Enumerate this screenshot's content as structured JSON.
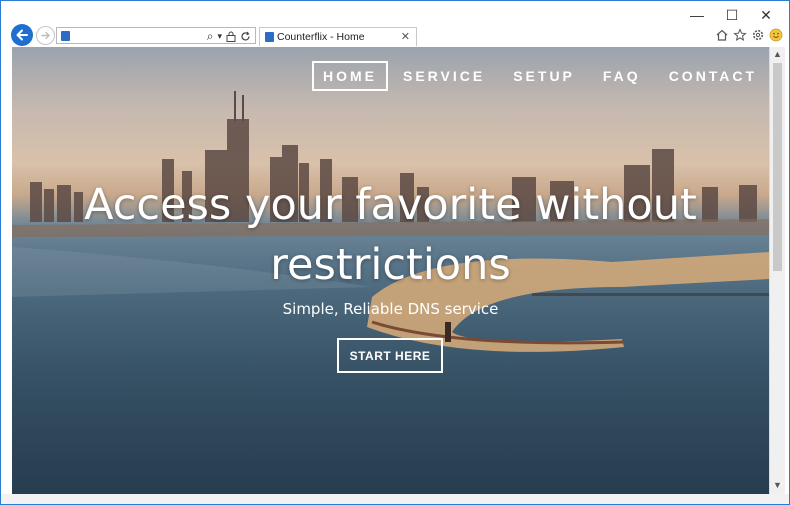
{
  "window": {
    "minimize_glyph": "—",
    "maximize_glyph": "☐",
    "close_glyph": "✕"
  },
  "address_bar": {
    "value": "",
    "search_glyph": "⌕",
    "dropdown_glyph": "▾"
  },
  "tab": {
    "title": "Counterflix - Home",
    "close_glyph": "✕"
  },
  "toolbar_icons": [
    "home-icon",
    "favorites-star-icon",
    "settings-gear-icon",
    "smiley-feedback-icon"
  ],
  "site": {
    "nav": [
      {
        "label": "HOME",
        "active": true
      },
      {
        "label": "SERVICE",
        "active": false
      },
      {
        "label": "SETUP",
        "active": false
      },
      {
        "label": "FAQ",
        "active": false
      },
      {
        "label": "CONTACT",
        "active": false
      }
    ],
    "hero_title_line1": "Access your favorite without",
    "hero_title_line2": "restrictions",
    "hero_subtitle": "Simple, Reliable DNS service",
    "cta_label": "START HERE"
  },
  "colors": {
    "accent_blue": "#1e6fd0",
    "window_border": "#2b7cd3"
  }
}
